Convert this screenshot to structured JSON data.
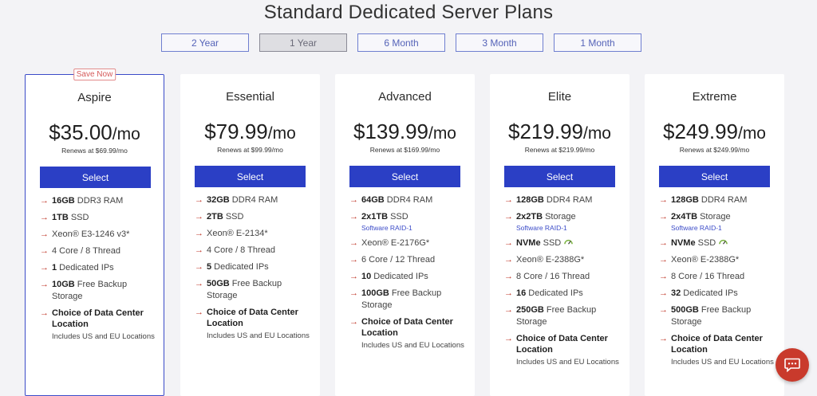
{
  "title": "Standard Dedicated Server Plans",
  "tabs": [
    {
      "label": "2 Year"
    },
    {
      "label": "1 Year"
    },
    {
      "label": "6 Month"
    },
    {
      "label": "3 Month"
    },
    {
      "label": "1 Month"
    }
  ],
  "active_tab": "1 Year",
  "select_label": "Select",
  "plans": [
    {
      "badge": "Save Now",
      "name": "Aspire",
      "price": "$35.00",
      "per": "/mo",
      "renews": "Renews at $69.99/mo",
      "features": [
        {
          "bold": "16GB",
          "text": " DDR3 RAM"
        },
        {
          "bold": "1TB",
          "text": " SSD"
        },
        {
          "bold": "",
          "text": "Xeon® E3-1246 v3*"
        },
        {
          "bold": "",
          "text": "4 Core / 8 Thread"
        },
        {
          "bold": "1",
          "text": " Dedicated IPs"
        },
        {
          "bold": "10GB",
          "text": " Free Backup Storage"
        },
        {
          "bold": "Choice of Data Center Location",
          "text": "",
          "note": "Includes US and EU Locations"
        }
      ]
    },
    {
      "name": "Essential",
      "price": "$79.99",
      "per": "/mo",
      "renews": "Renews at $99.99/mo",
      "features": [
        {
          "bold": "32GB",
          "text": " DDR4 RAM"
        },
        {
          "bold": "2TB",
          "text": " SSD"
        },
        {
          "bold": "",
          "text": "Xeon® E-2134*"
        },
        {
          "bold": "",
          "text": "4 Core / 8 Thread"
        },
        {
          "bold": "5",
          "text": " Dedicated IPs"
        },
        {
          "bold": "50GB",
          "text": " Free Backup Storage"
        },
        {
          "bold": "Choice of Data Center Location",
          "text": "",
          "note": "Includes US and EU Locations"
        }
      ]
    },
    {
      "name": "Advanced",
      "price": "$139.99",
      "per": "/mo",
      "renews": "Renews at $169.99/mo",
      "features": [
        {
          "bold": "64GB",
          "text": " DDR4 RAM"
        },
        {
          "bold": "2x1TB",
          "text": " SSD",
          "sub": "Software RAID-1"
        },
        {
          "bold": "",
          "text": "Xeon® E-2176G*"
        },
        {
          "bold": "",
          "text": "6 Core / 12 Thread"
        },
        {
          "bold": "10",
          "text": " Dedicated IPs"
        },
        {
          "bold": "100GB",
          "text": " Free Backup Storage"
        },
        {
          "bold": "Choice of Data Center Location",
          "text": "",
          "note": "Includes US and EU Locations"
        }
      ]
    },
    {
      "name": "Elite",
      "price": "$219.99",
      "per": "/mo",
      "renews": "Renews at $219.99/mo",
      "features": [
        {
          "bold": "128GB",
          "text": " DDR4 RAM"
        },
        {
          "bold": "2x2TB",
          "text": " Storage",
          "sub": "Software RAID-1"
        },
        {
          "bold": "NVMe",
          "text": " SSD",
          "icon": "speed-icon"
        },
        {
          "bold": "",
          "text": "Xeon® E-2388G*"
        },
        {
          "bold": "",
          "text": "8 Core / 16 Thread"
        },
        {
          "bold": "16",
          "text": " Dedicated IPs"
        },
        {
          "bold": "250GB",
          "text": " Free Backup Storage"
        },
        {
          "bold": "Choice of Data Center Location",
          "text": "",
          "note": "Includes US and EU Locations"
        }
      ]
    },
    {
      "name": "Extreme",
      "price": "$249.99",
      "per": "/mo",
      "renews": "Renews at $249.99/mo",
      "features": [
        {
          "bold": "128GB",
          "text": " DDR4 RAM"
        },
        {
          "bold": "2x4TB",
          "text": " Storage",
          "sub": "Software RAID-1"
        },
        {
          "bold": "NVMe",
          "text": " SSD",
          "icon": "speed-icon"
        },
        {
          "bold": "",
          "text": "Xeon® E-2388G*"
        },
        {
          "bold": "",
          "text": "8 Core / 16 Thread"
        },
        {
          "bold": "32",
          "text": " Dedicated IPs"
        },
        {
          "bold": "500GB",
          "text": " Free Backup Storage"
        },
        {
          "bold": "Choice of Data Center Location",
          "text": "",
          "note": "Includes US and EU Locations"
        }
      ]
    }
  ],
  "colors": {
    "accent": "#2b3fc5",
    "arrow": "#c0392b",
    "badge": "#d55a5a",
    "chat": "#c93a2c"
  },
  "chat_icon": "chat-bubble-icon"
}
